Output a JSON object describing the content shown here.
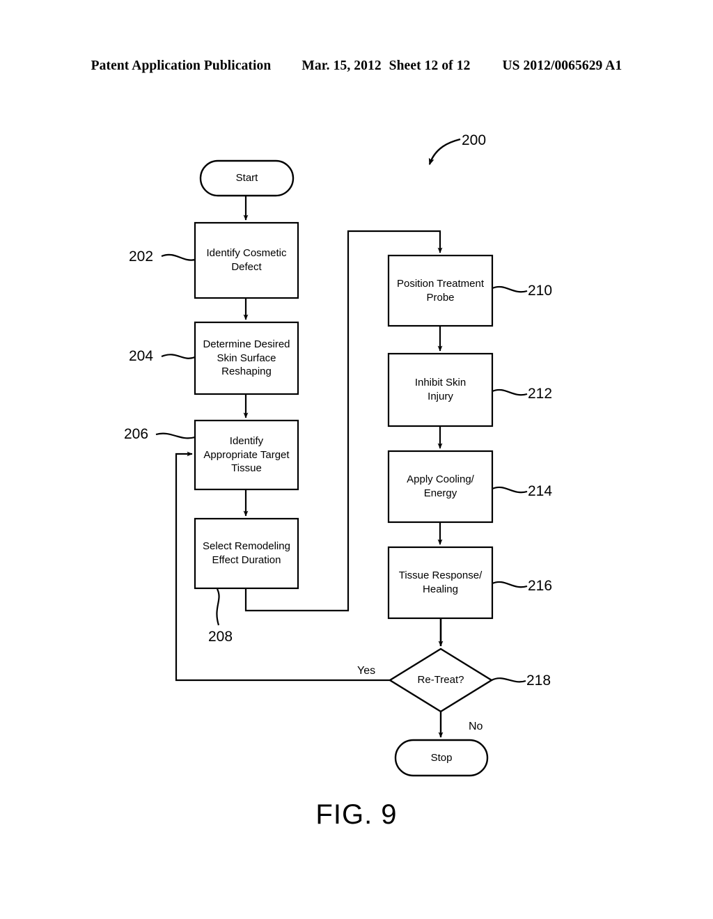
{
  "header": {
    "publication": "Patent Application Publication",
    "date": "Mar. 15, 2012",
    "sheet": "Sheet 12 of 12",
    "document_number": "US 2012/0065629 A1"
  },
  "figure": {
    "caption": "FIG. 9",
    "diagram_reference": "200"
  },
  "nodes": {
    "start": {
      "label": "Start",
      "shape": "terminator"
    },
    "identify_defect": {
      "label": "Identify Cosmetic\nDefect",
      "shape": "process",
      "ref": "202"
    },
    "determine_reshaping": {
      "label": "Determine Desired\nSkin Surface\nReshaping",
      "shape": "process",
      "ref": "204"
    },
    "identify_tissue": {
      "label": "Identify\nAppropriate Target\nTissue",
      "shape": "process",
      "ref": "206"
    },
    "select_duration": {
      "label": "Select Remodeling\nEffect Duration",
      "shape": "process",
      "ref": "208"
    },
    "position_probe": {
      "label": "Position Treatment\nProbe",
      "shape": "process",
      "ref": "210"
    },
    "inhibit_injury": {
      "label": "Inhibit Skin\nInjury",
      "shape": "process",
      "ref": "212"
    },
    "apply_cooling": {
      "label": "Apply Cooling/\nEnergy",
      "shape": "process",
      "ref": "214"
    },
    "tissue_response": {
      "label": "Tissue Response/\nHealing",
      "shape": "process",
      "ref": "216"
    },
    "retreat_decision": {
      "label": "Re-Treat?",
      "shape": "decision",
      "ref": "218"
    },
    "stop": {
      "label": "Stop",
      "shape": "terminator"
    }
  },
  "edge_labels": {
    "retreat_yes": "Yes",
    "retreat_no": "No"
  },
  "colors": {
    "ink": "#000000",
    "paper": "#ffffff"
  }
}
